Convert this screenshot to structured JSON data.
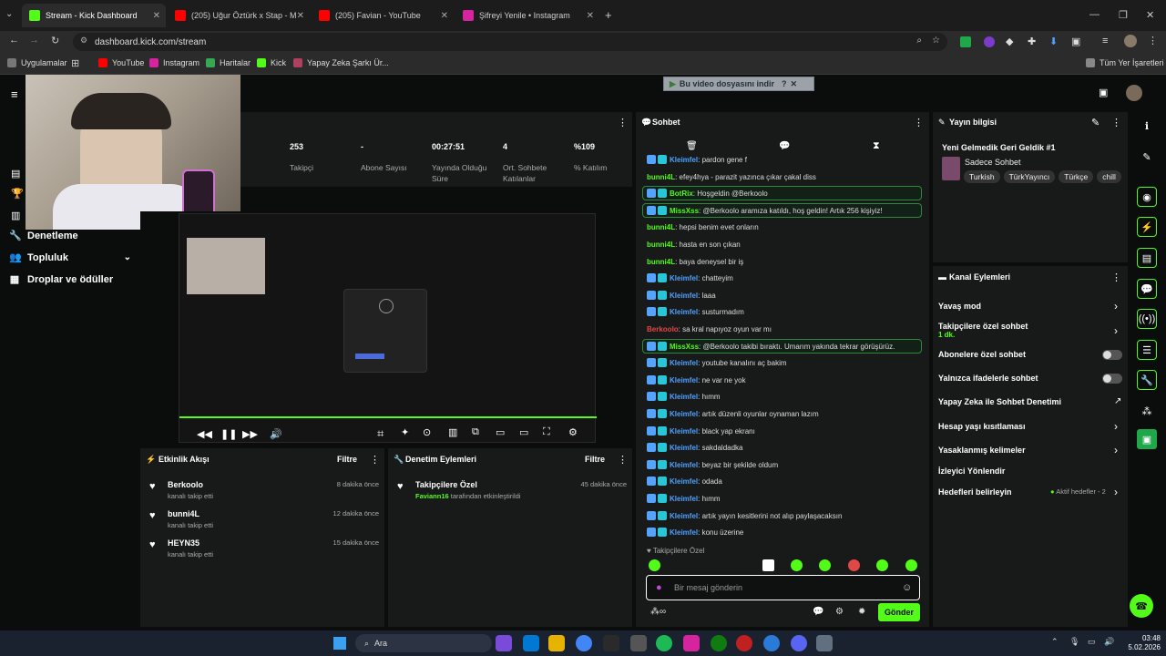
{
  "browser": {
    "tabs": [
      {
        "title": "Stream - Kick Dashboard",
        "color": "#53fc18"
      },
      {
        "title": "(205) Uğur Öztürk x Stap - M",
        "color": "#ff0000"
      },
      {
        "title": "(205) Favian - YouTube",
        "color": "#ff0000"
      },
      {
        "title": "Şifreyi Yenile • Instagram",
        "color": "#d6249f"
      }
    ],
    "url": "dashboard.kick.com/stream",
    "bookmarks": [
      "Uygulamalar",
      "YouTube",
      "Instagram",
      "Haritalar",
      "Kick",
      "Yapay Zeka Şarkı Ür..."
    ],
    "bookmarks_right": "Tüm Yer İşaretleri"
  },
  "download_banner": "Bu video dosyasını indir",
  "nav": {
    "items": [
      "Denetleme",
      "Topluluk",
      "Droplar ve ödüller"
    ]
  },
  "stats": [
    {
      "value": "253",
      "label": "Takipçi"
    },
    {
      "value": "-",
      "label": "Abone Sayısı"
    },
    {
      "value": "00:27:51",
      "label": "Yayında Olduğu Süre"
    },
    {
      "value": "4",
      "label": "Ort. Sohbete Katılanlar"
    },
    {
      "value": "%109",
      "label": "% Katılım"
    }
  ],
  "activity": {
    "title": "Etkinlik Akışı",
    "filter": "Filtre",
    "items": [
      {
        "name": "Berkoolo",
        "sub": "kanalı takip etti",
        "time": "8 dakika önce"
      },
      {
        "name": "bunni4L",
        "sub": "kanalı takip etti",
        "time": "12 dakika önce"
      },
      {
        "name": "HEYN35",
        "sub": "kanalı takip etti",
        "time": "15 dakika önce"
      }
    ]
  },
  "moderation": {
    "title": "Denetim Eylemleri",
    "filter": "Filtre",
    "item": {
      "title": "Takipçilere Özel",
      "by": "Faviann16",
      "rest": " tarafından etkinleştirildi",
      "time": "45 dakika önce"
    }
  },
  "chat": {
    "title": "Sohbet",
    "messages": [
      {
        "user": "Kleimfel",
        "text": ": pardon gene f",
        "style": "blue",
        "badges": true
      },
      {
        "user": "bunni4L",
        "text": ": efey4hya - parazit yazınca çıkar çakal diss",
        "style": "green",
        "badges": false
      },
      {
        "user": "BotRix",
        "text": ": Hoşgeldin @Berkoolo",
        "style": "hl",
        "badges": true
      },
      {
        "user": "MissXss",
        "text": ": @Berkoolo aramıza katıldı, hoş geldin! Artık 256 kişiyiz!",
        "style": "hl",
        "badges": true
      },
      {
        "user": "bunni4L",
        "text": ": hepsi benim evet onların",
        "style": "green",
        "badges": false
      },
      {
        "user": "bunni4L",
        "text": ": hasta en son çıkan",
        "style": "green",
        "badges": false
      },
      {
        "user": "bunni4L",
        "text": ": baya deneysel bir iş",
        "style": "green",
        "badges": false
      },
      {
        "user": "Kleimfel",
        "text": ": chatteyim",
        "style": "blue",
        "badges": true
      },
      {
        "user": "Kleimfel",
        "text": ": laaa",
        "style": "blue",
        "badges": true
      },
      {
        "user": "Kleimfel",
        "text": ": susturmadım",
        "style": "blue",
        "badges": true
      },
      {
        "user": "Berkoolo",
        "text": ": sa kral napıyoz oyun var mı",
        "style": "red",
        "badges": false
      },
      {
        "user": "MissXss",
        "text": ": @Berkoolo takibi bıraktı. Umarım yakında tekrar görüşürüz.",
        "style": "hl",
        "badges": true
      },
      {
        "user": "Kleimfel",
        "text": ": youtube kanalını aç bakim",
        "style": "blue",
        "badges": true
      },
      {
        "user": "Kleimfel",
        "text": ": ne var ne yok",
        "style": "blue",
        "badges": true
      },
      {
        "user": "Kleimfel",
        "text": ": hımm",
        "style": "blue",
        "badges": true
      },
      {
        "user": "Kleimfel",
        "text": ": artık düzenli oyunlar oynaman lazım",
        "style": "blue",
        "badges": true
      },
      {
        "user": "Kleimfel",
        "text": ": black yap ekranı",
        "style": "blue",
        "badges": true
      },
      {
        "user": "Kleimfel",
        "text": ": sakdaldadka",
        "style": "blue",
        "badges": true
      },
      {
        "user": "Kleimfel",
        "text": ": beyaz bir şekilde oldum",
        "style": "blue",
        "badges": true
      },
      {
        "user": "Kleimfel",
        "text": ": odada",
        "style": "blue",
        "badges": true
      },
      {
        "user": "Kleimfel",
        "text": ": hımm",
        "style": "blue",
        "badges": true
      },
      {
        "user": "Kleimfel",
        "text": ": artık yayın kesitlerini not alıp paylaşacaksın",
        "style": "blue",
        "badges": true
      },
      {
        "user": "Kleimfel",
        "text": ": konu üzerine",
        "style": "blue",
        "badges": true
      }
    ],
    "mode_label": "Takipçilere Özel",
    "input_placeholder": "Bir mesaj gönderin",
    "send": "Gönder"
  },
  "stream_info": {
    "title": "Yayın bilgisi",
    "stream_title": "Yeni Gelmedik Geri Geldik #1",
    "category": "Sadece Sohbet",
    "tags": [
      "Turkish",
      "TürkYayıncı",
      "Türkçe",
      "chill"
    ]
  },
  "channel_actions": {
    "title": "Kanal Eylemleri",
    "items": [
      {
        "label": "Yavaş mod",
        "kind": "chev"
      },
      {
        "label": "Takipçilere özel sohbet",
        "sub": "1 dk.",
        "kind": "chev"
      },
      {
        "label": "Abonelere özel sohbet",
        "kind": "toggle"
      },
      {
        "label": "Yalnızca ifadelerle sohbet",
        "kind": "toggle"
      },
      {
        "label": "Yapay Zeka ile Sohbet Denetimi",
        "kind": "ext"
      },
      {
        "label": "Hesap yaşı kısıtlaması",
        "kind": "chev"
      },
      {
        "label": "Yasaklanmış kelimeler",
        "kind": "chev"
      },
      {
        "label": "İzleyici Yönlendir",
        "kind": "none"
      },
      {
        "label": "Hedefleri belirleyin",
        "kind": "chev",
        "note": "Aktif hedefler - 2"
      }
    ]
  },
  "taskbar": {
    "search": "Ara",
    "time": "03:48",
    "date": "5.02.2026"
  }
}
